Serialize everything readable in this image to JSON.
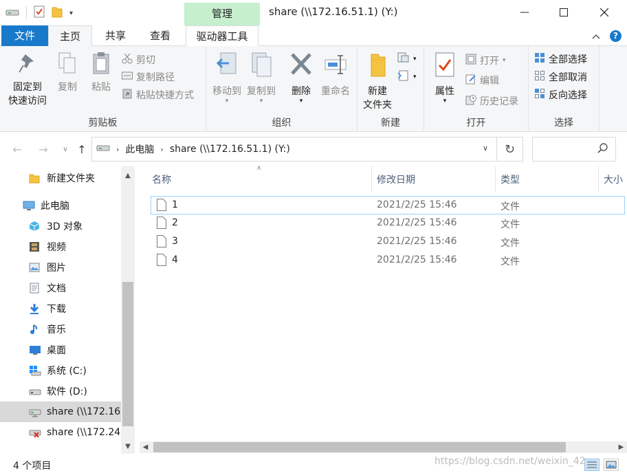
{
  "window": {
    "title": "share (\\\\172.16.51.1) (Y:)",
    "context_tab": "管理",
    "controls": {
      "minimize": "—",
      "maximize": "☐",
      "close": "✕"
    }
  },
  "ribbon_tabs": {
    "file": "文件",
    "home": "主页",
    "share": "共享",
    "view": "查看",
    "drive_tools": "驱动器工具"
  },
  "ribbon": {
    "clipboard": {
      "label": "剪贴板",
      "pin_quick_access_line1": "固定到",
      "pin_quick_access_line2": "快速访问",
      "copy": "复制",
      "paste": "粘贴",
      "cut": "剪切",
      "copy_path": "复制路径",
      "paste_shortcut": "粘贴快捷方式"
    },
    "organize": {
      "label": "组织",
      "move_to": "移动到",
      "copy_to": "复制到",
      "delete": "删除",
      "rename": "重命名"
    },
    "new": {
      "label": "新建",
      "new_folder_line1": "新建",
      "new_folder_line2": "文件夹"
    },
    "open": {
      "label": "打开",
      "properties": "属性",
      "open": "打开",
      "edit": "编辑",
      "history": "历史记录"
    },
    "select": {
      "label": "选择",
      "select_all": "全部选择",
      "select_none": "全部取消",
      "invert": "反向选择"
    }
  },
  "address": {
    "this_pc": "此电脑",
    "current": "share (\\\\172.16.51.1) (Y:)"
  },
  "nav_pane": {
    "items": [
      {
        "label": "新建文件夹",
        "icon": "folder-icon"
      },
      {
        "label": "此电脑",
        "icon": "computer-icon"
      },
      {
        "label": "3D 对象",
        "icon": "cube-icon"
      },
      {
        "label": "视频",
        "icon": "film-icon"
      },
      {
        "label": "图片",
        "icon": "picture-icon"
      },
      {
        "label": "文档",
        "icon": "document-icon"
      },
      {
        "label": "下载",
        "icon": "download-icon"
      },
      {
        "label": "音乐",
        "icon": "music-icon"
      },
      {
        "label": "桌面",
        "icon": "desktop-icon"
      },
      {
        "label": "系统 (C:)",
        "icon": "system-drive-icon"
      },
      {
        "label": "软件 (D:)",
        "icon": "drive-icon"
      },
      {
        "label": "share (\\\\172.16",
        "icon": "network-drive-icon"
      },
      {
        "label": "share (\\\\172.24",
        "icon": "disconnected-drive-icon"
      }
    ]
  },
  "file_list": {
    "columns": {
      "name": "名称",
      "modified": "修改日期",
      "type": "类型",
      "size": "大小"
    },
    "rows": [
      {
        "name": "1",
        "modified": "2021/2/25 15:46",
        "type": "文件"
      },
      {
        "name": "2",
        "modified": "2021/2/25 15:46",
        "type": "文件"
      },
      {
        "name": "3",
        "modified": "2021/2/25 15:46",
        "type": "文件"
      },
      {
        "name": "4",
        "modified": "2021/2/25 15:46",
        "type": "文件"
      }
    ]
  },
  "status": {
    "count": "4 个项目",
    "watermark": "https://blog.csdn.net/weixin_42"
  },
  "colors": {
    "file_tab": "#1979ca",
    "manage_tab": "#c6efce",
    "selection": "#d9d9d9"
  }
}
